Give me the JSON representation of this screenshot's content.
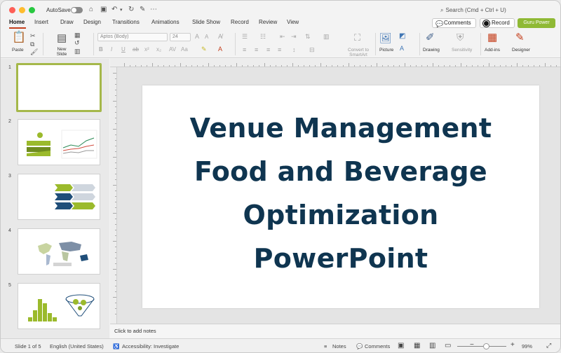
{
  "titlebar": {
    "autosave_label": "AutoSave",
    "search_placeholder": "Search (Cmd + Ctrl + U)"
  },
  "tabs": [
    "Home",
    "Insert",
    "Draw",
    "Design",
    "Transitions",
    "Animations",
    "Slide Show",
    "Record",
    "Review",
    "View"
  ],
  "header_buttons": {
    "comments": "Comments",
    "record": "Record",
    "guru": "Guru Power"
  },
  "ribbon": {
    "paste": "Paste",
    "new_slide": "New Slide",
    "font_name": "Aptos (Body)",
    "font_size": "24",
    "convert_smartart": "Convert to SmartArt",
    "picture": "Picture",
    "drawing": "Drawing",
    "sensitivity": "Sensitivity",
    "addins": "Add-ins",
    "designer": "Designer"
  },
  "thumbnails": [
    {
      "number": "1"
    },
    {
      "number": "2"
    },
    {
      "number": "3"
    },
    {
      "number": "4"
    },
    {
      "number": "5"
    }
  ],
  "slide": {
    "title_lines": [
      "Venue Management",
      "Food and Beverage",
      "Optimization",
      "PowerPoint"
    ]
  },
  "notes_placeholder": "Click to add notes",
  "status": {
    "slide_counter": "Slide 1 of 5",
    "language": "English (United States)",
    "accessibility": "Accessibility: Investigate",
    "notes": "Notes",
    "comments": "Comments",
    "zoom": "99%"
  },
  "colors": {
    "accent_green": "#8fb935",
    "title_navy": "#0f3550",
    "tab_underline": "#c43e1c"
  }
}
